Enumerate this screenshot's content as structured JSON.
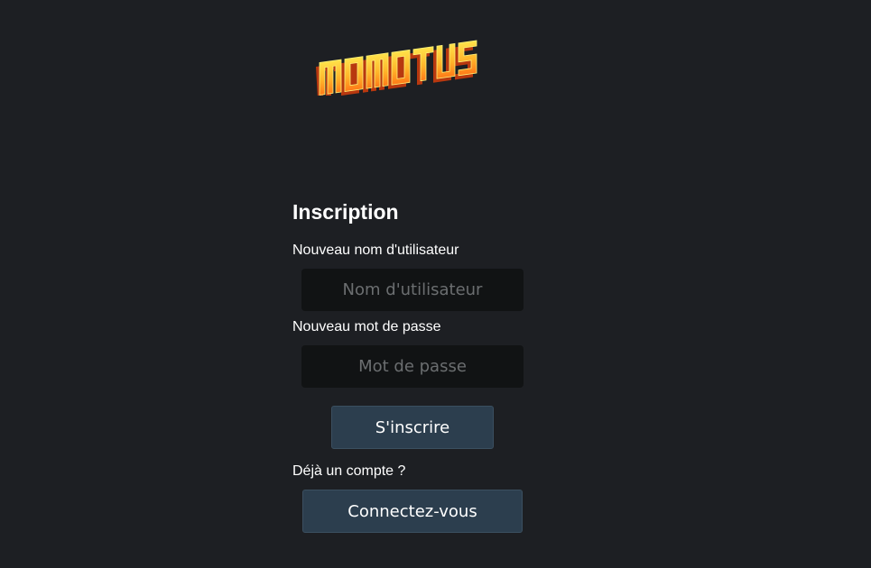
{
  "logo": {
    "text": "MOMOTUS",
    "colors": {
      "face_top": "#ffe24a",
      "face_bottom": "#ff8a1c",
      "shade": "#c23b12",
      "highlight": "#fff27a"
    }
  },
  "form": {
    "title": "Inscription",
    "username_label": "Nouveau nom d'utilisateur",
    "username_placeholder": "Nom d'utilisateur",
    "username_value": "",
    "password_label": "Nouveau mot de passe",
    "password_placeholder": "Mot de passe",
    "password_value": "",
    "register_button": "S'inscrire",
    "have_account_text": "Déjà un compte ?",
    "login_button": "Connectez-vous"
  },
  "colors": {
    "background": "#1d1f23",
    "input_background": "#111314",
    "button_background": "#2c3e4e",
    "text": "#ffffff"
  }
}
